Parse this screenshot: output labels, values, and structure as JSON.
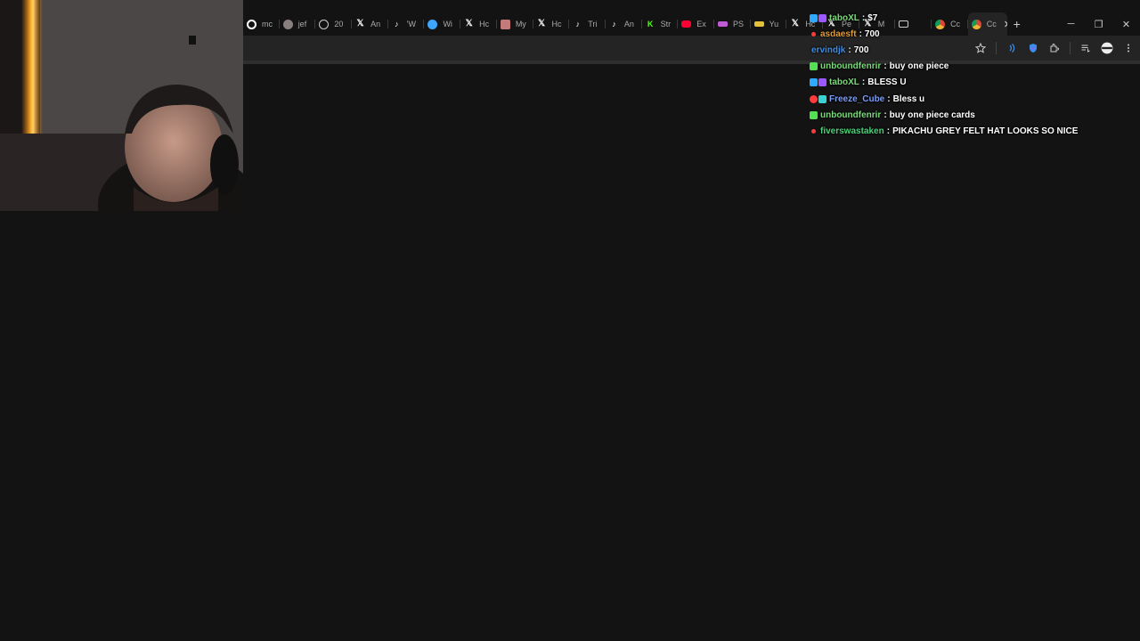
{
  "browser": {
    "tabs": [
      {
        "label": "mc",
        "icon": "google-icon",
        "color": "#ffffff"
      },
      {
        "label": "jef",
        "icon": "avatar-icon",
        "color": "#8a7f7f"
      },
      {
        "label": "20",
        "icon": "threads-icon",
        "color": "#cccccc"
      },
      {
        "label": "An",
        "icon": "x-icon",
        "color": "#ffffff"
      },
      {
        "label": "'W",
        "icon": "tiktok-icon",
        "color": "#ffffff"
      },
      {
        "label": "Wi",
        "icon": "web-icon",
        "color": "#3ea6ff"
      },
      {
        "label": "Hc",
        "icon": "x-icon",
        "color": "#ffffff"
      },
      {
        "label": "My",
        "icon": "thumb-icon",
        "color": "#c27a7a"
      },
      {
        "label": "Hc",
        "icon": "x-icon",
        "color": "#ffffff"
      },
      {
        "label": "Tri",
        "icon": "tiktok-icon",
        "color": "#ffffff"
      },
      {
        "label": "An",
        "icon": "tiktok-icon",
        "color": "#ffffff"
      },
      {
        "label": "Str",
        "icon": "kick-icon",
        "color": "#53fc18"
      },
      {
        "label": "Ex",
        "icon": "youtube-icon",
        "color": "#ff0033"
      },
      {
        "label": "PS",
        "icon": "flag-icon",
        "color": "#c05bd8"
      },
      {
        "label": "Yu",
        "icon": "flag-icon",
        "color": "#e3c13b"
      },
      {
        "label": "Hc",
        "icon": "x-icon",
        "color": "#ffffff"
      },
      {
        "label": "Pe",
        "icon": "x-icon",
        "color": "#ffffff"
      },
      {
        "label": "M",
        "icon": "x-icon",
        "color": "#ffffff"
      },
      {
        "label": "",
        "icon": "window-icon",
        "color": "#cccccc"
      },
      {
        "label": "Cc",
        "icon": "chrome-icon",
        "color": "#f2b233"
      },
      {
        "label": "Cc",
        "icon": "chrome-icon",
        "color": "#f2b233",
        "active": true
      }
    ],
    "new_tab_label": "+",
    "window": {
      "minimize": "─",
      "maximize": "❐",
      "close": "✕"
    }
  },
  "chat": {
    "messages": [
      {
        "user": "taboXL",
        "user_color": "#7cd97c",
        "badges": [
          "#2fa8ff",
          "#9b59ff"
        ],
        "text": "$7"
      },
      {
        "user": "asdaesft",
        "user_color": "#e09b38",
        "badges": [
          "#ff3b3b"
        ],
        "text": "700"
      },
      {
        "user": "ervindjk",
        "user_color": "#3c8fe8",
        "badges": [],
        "text": "700"
      },
      {
        "user": "unboundfenrir",
        "user_color": "#7cd97c",
        "badges": [
          "#53e053"
        ],
        "text": "buy one piece"
      },
      {
        "user": "taboXL",
        "user_color": "#7cd97c",
        "badges": [
          "#2fa8ff",
          "#9b59ff"
        ],
        "text": "BLESS U"
      },
      {
        "user": "Freeze_Cube",
        "user_color": "#7c9cf5",
        "badges": [
          "#ff3b3b",
          "#3ad2d2"
        ],
        "text": "Bless u"
      },
      {
        "user": "unboundfenrir",
        "user_color": "#7cd97c",
        "badges": [
          "#53e053"
        ],
        "text": "buy one piece cards"
      },
      {
        "user": "fiverswastaken",
        "user_color": "#4fd17a",
        "badges": [
          "#ff3b3b"
        ],
        "text": "PIKACHU GREY FELT HAT LOOKS SO NICE"
      }
    ]
  }
}
